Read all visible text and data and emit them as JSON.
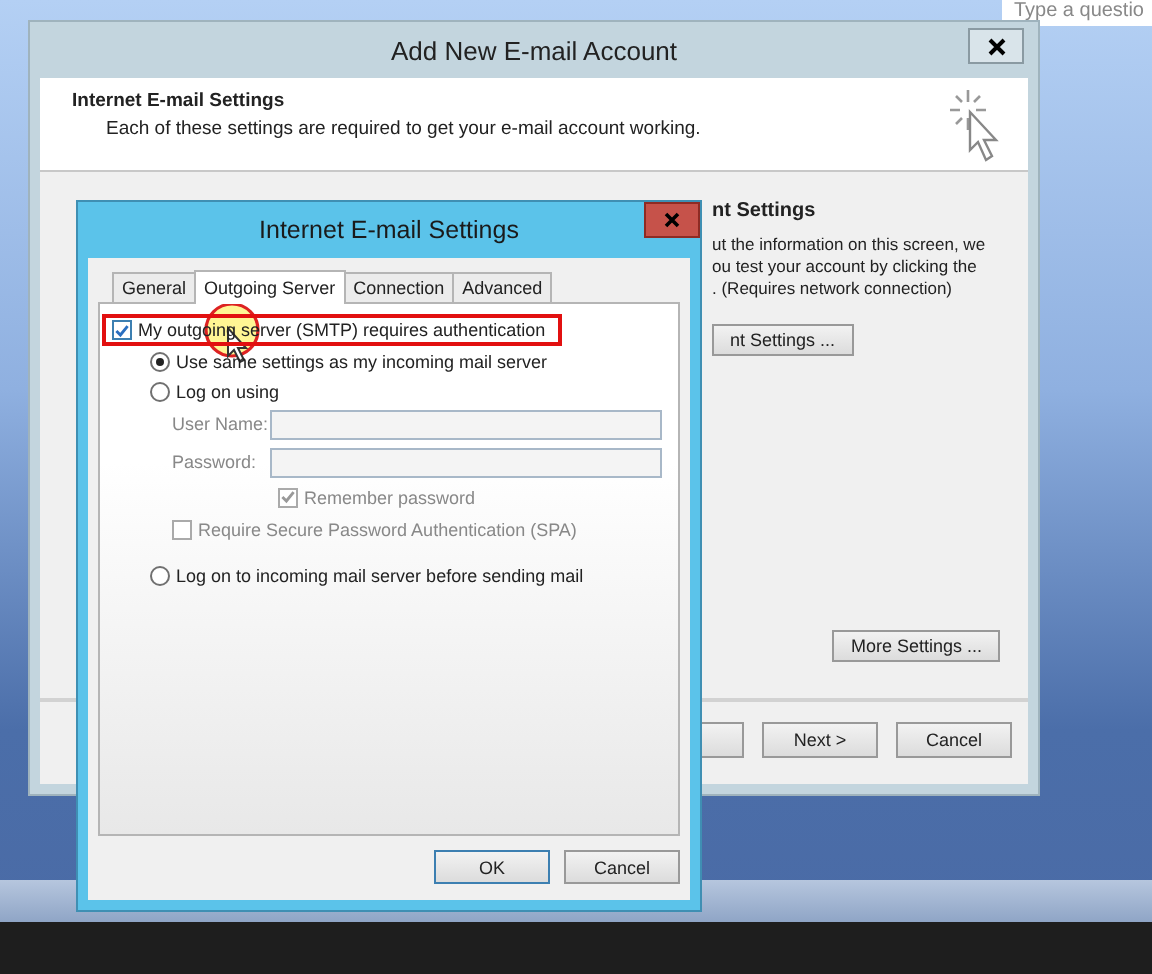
{
  "desktop": {
    "search_hint": "Type a questio"
  },
  "back_window": {
    "title": "Add New E-mail Account",
    "header_title": "Internet E-mail Settings",
    "header_text": "Each of these settings are required to get your e-mail account working.",
    "right_heading": "nt Settings",
    "right_text": [
      "ut the information on this screen, we",
      "ou test your account by clicking the",
      ". (Requires network connection)"
    ],
    "test_button": "nt Settings ...",
    "more_button": "More Settings ...",
    "footer_buttons": [
      "Next >",
      "Cancel"
    ]
  },
  "dialog": {
    "title": "Internet E-mail Settings",
    "tabs": [
      {
        "label": "General",
        "selected": false
      },
      {
        "label": "Outgoing Server",
        "selected": true
      },
      {
        "label": "Connection",
        "selected": false
      },
      {
        "label": "Advanced",
        "selected": false
      }
    ],
    "auth": {
      "label": "My outgoing server (SMTP) requires authentication",
      "checked": true,
      "highlighted": true,
      "children": [
        {
          "kind": "radio",
          "label": "Use same settings as my incoming mail server",
          "selected": true
        },
        {
          "kind": "radio",
          "label": "Log on using",
          "selected": false,
          "children": [
            {
              "kind": "field",
              "label": "User Name:",
              "disabled": true
            },
            {
              "kind": "field",
              "label": "Password:",
              "disabled": true
            },
            {
              "kind": "subcheck",
              "label": "Remember password",
              "checked": true,
              "disabled": true
            },
            {
              "kind": "checkbox",
              "label": "Require Secure Password Authentication (SPA)",
              "checked": false,
              "disabled": true
            }
          ]
        },
        {
          "kind": "radio",
          "label": "Log on to incoming mail server before sending mail",
          "selected": false
        }
      ]
    },
    "buttons": [
      "OK",
      "Cancel"
    ]
  }
}
